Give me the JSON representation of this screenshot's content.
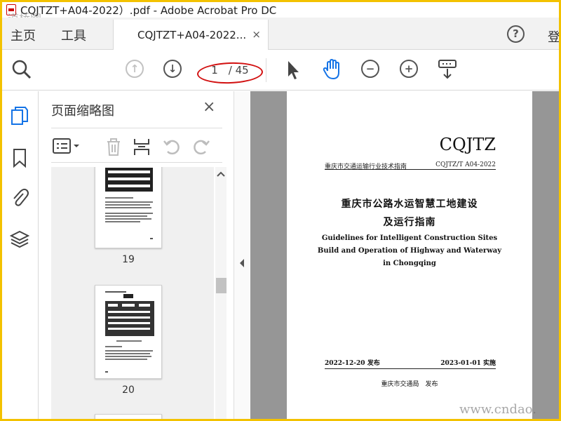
{
  "window": {
    "title": "CQJTZT+A04-2022）.pdf - Adobe Acrobat Pro DC"
  },
  "watermark": {
    "top": "道桥网",
    "bottom": "www.cndao."
  },
  "menu": {
    "home": "主页",
    "tools": "工具",
    "login": "登"
  },
  "tab": {
    "label": "CQJTZT+A04-2022...",
    "close": "×"
  },
  "help_label": "?",
  "toolbar": {
    "page_current": "1",
    "page_total": "/ 45",
    "icons": [
      "search-zoom-icon",
      "page-up-icon",
      "page-down-icon",
      "select-cursor-icon",
      "hand-tool-icon",
      "zoom-out-icon",
      "zoom-in-icon",
      "scroll-mode-icon"
    ]
  },
  "sidebar_icons": [
    "pages-icon",
    "bookmark-icon",
    "attachment-icon",
    "layers-icon"
  ],
  "thumbnail_panel": {
    "title": "页面缩略图",
    "close": "×",
    "tools": [
      "options-icon",
      "delete-icon",
      "insert-page-icon",
      "rotate-left-icon",
      "rotate-right-icon"
    ],
    "pages": [
      {
        "label": "19"
      },
      {
        "label": "20"
      }
    ]
  },
  "document": {
    "code": "CQJTZ",
    "header_left": "重庆市交通运输行业技术指南",
    "header_right": "CQJTZ/T A04-2022",
    "title_line1": "重庆市公路水运智慧工地建设",
    "title_line2": "及运行指南",
    "en_line1": "Guidelines for Intelligent Construction Sites",
    "en_line2": "Build and Operation of Highway and Waterway",
    "en_line3": "in Chongqing",
    "issue_date": "2022-12-20 发布",
    "effective_date": "2023-01-01 实施",
    "publisher": "重庆市交通局　发布"
  },
  "colors": {
    "accent_blue": "#1473e6",
    "frame_yellow": "#f3c200",
    "annotation_red": "#d21010"
  }
}
